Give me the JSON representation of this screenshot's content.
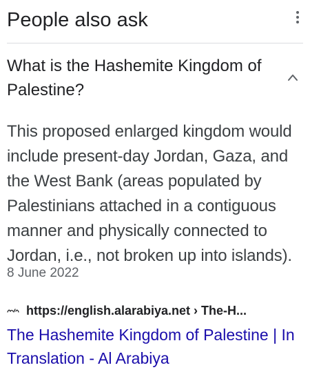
{
  "header": {
    "title": "People also ask",
    "more_icon": "vertical-dots-icon"
  },
  "question": {
    "text": "What is the Hashemite Kingdom of Palestine?",
    "expanded": true,
    "chevron_icon": "chevron-up-icon"
  },
  "answer": {
    "text": "This proposed enlarged kingdom would include present-day Jordan, Gaza, and the West Bank (areas populated by Palestinians attached in a contiguous manner and physically connected to Jordan, i.e., not broken up into islands).",
    "date": "8 June 2022"
  },
  "source": {
    "favicon": "al-arabiya-logo",
    "url": "https://english.alarabiya.net › The-H...",
    "link_text": "The Hashemite Kingdom of Palestine | In Translation - Al Arabiya"
  },
  "colors": {
    "link": "#1a0dab",
    "text": "#202124",
    "muted": "#5f6368",
    "divider": "#dadce0"
  }
}
